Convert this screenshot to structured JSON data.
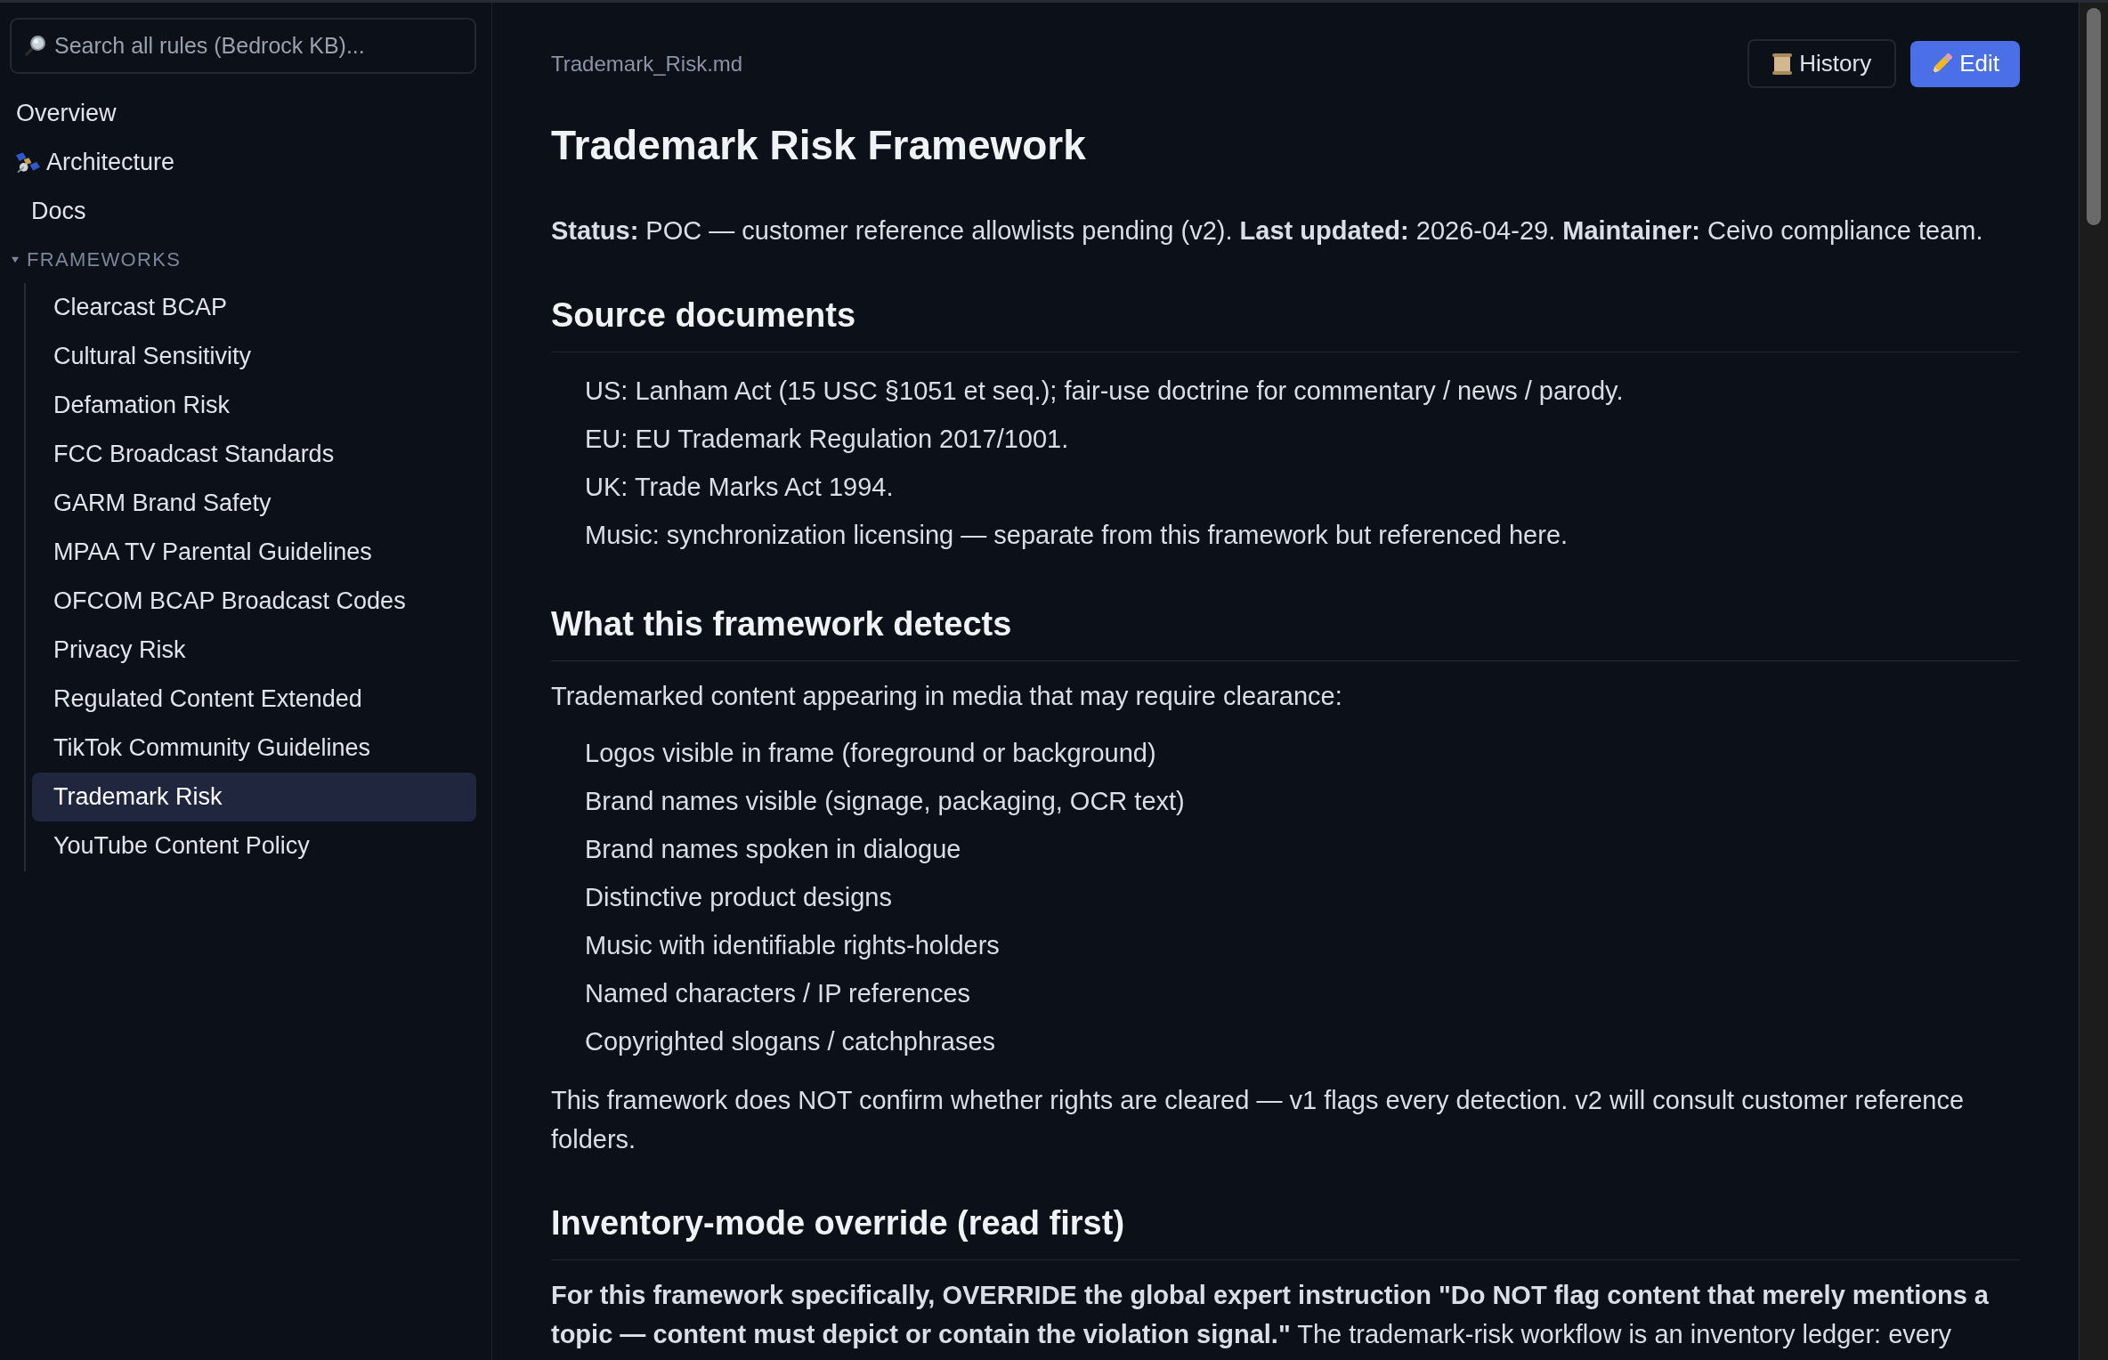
{
  "sidebar": {
    "search": {
      "placeholder": "Search all rules (Bedrock KB)..."
    },
    "items": [
      {
        "label": "Overview",
        "kind": "plain",
        "selected": false
      },
      {
        "label": "Architecture",
        "kind": "icon",
        "selected": false
      },
      {
        "label": "Docs",
        "kind": "indented",
        "selected": false
      }
    ],
    "section": {
      "title": "FRAMEWORKS",
      "expanded": true,
      "items": [
        {
          "label": "Clearcast BCAP",
          "selected": false
        },
        {
          "label": "Cultural Sensitivity",
          "selected": false
        },
        {
          "label": "Defamation Risk",
          "selected": false
        },
        {
          "label": "FCC Broadcast Standards",
          "selected": false
        },
        {
          "label": "GARM Brand Safety",
          "selected": false
        },
        {
          "label": "MPAA TV Parental Guidelines",
          "selected": false
        },
        {
          "label": "OFCOM BCAP Broadcast Codes",
          "selected": false
        },
        {
          "label": "Privacy Risk",
          "selected": false
        },
        {
          "label": "Regulated Content Extended",
          "selected": false
        },
        {
          "label": "TikTok Community Guidelines",
          "selected": false
        },
        {
          "label": "Trademark Risk",
          "selected": true
        },
        {
          "label": "YouTube Content Policy",
          "selected": false
        }
      ]
    }
  },
  "document": {
    "file_name": "Trademark_Risk.md",
    "buttons": [
      {
        "label": "History",
        "kind": "secondary"
      },
      {
        "label": "Edit",
        "kind": "primary"
      }
    ],
    "title": "Trademark Risk Framework",
    "status": "**Status:** POC — customer reference allowlists pending (v2). **Last updated:** 2026-04-29. **Maintainer:** Ceivo compliance team.",
    "sections": [
      {
        "heading": "Source documents",
        "blocks": [
          {
            "kind": "list",
            "items": [
              "US: Lanham Act (15 USC §1051 et seq.); fair-use doctrine for commentary / news / parody.",
              "EU: EU Trademark Regulation 2017/1001.",
              "UK: Trade Marks Act 1994.",
              "Music: synchronization licensing — separate from this framework but referenced here."
            ]
          }
        ]
      },
      {
        "heading": "What this framework detects",
        "blocks": [
          {
            "kind": "paragraph",
            "text": "Trademarked content appearing in media that may require clearance:"
          },
          {
            "kind": "list",
            "items": [
              "Logos visible in frame (foreground or background)",
              "Brand names visible (signage, packaging, OCR text)",
              "Brand names spoken in dialogue",
              "Distinctive product designs",
              "Music with identifiable rights-holders",
              "Named characters / IP references",
              "Copyrighted slogans / catchphrases"
            ]
          },
          {
            "kind": "paragraph",
            "text": "This framework does NOT confirm whether rights are cleared — v1 flags every detection. v2 will consult customer reference folders."
          }
        ]
      },
      {
        "heading": "Inventory-mode override (read first)",
        "blocks": [
          {
            "kind": "paragraph",
            "text": "**For this framework specifically, OVERRIDE the global expert instruction \"Do NOT flag content that merely mentions a topic — content must depict or contain the violation signal.\"** The trademark-risk workflow is an inventory ledger: every"
          }
        ]
      }
    ]
  }
}
